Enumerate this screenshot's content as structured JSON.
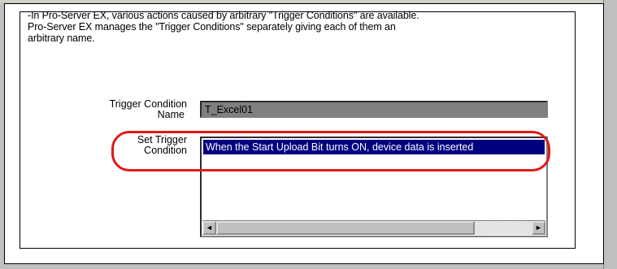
{
  "description": {
    "line1": "-In Pro-Server EX, various actions caused by arbitrary \"Trigger Conditions\" are available.",
    "line2": "Pro-Server EX manages the \"Trigger Conditions\" separately giving each of them an",
    "line3": "arbitrary name."
  },
  "trigger_condition_name": {
    "label_line1": "Trigger Condition",
    "label_line2": "Name",
    "value": "T_Excel01"
  },
  "set_trigger_condition": {
    "label_line1": "Set Trigger",
    "label_line2": "Condition",
    "selected_line": "When the Start Upload Bit turns ON, device data is inserted"
  },
  "scrollbar": {
    "left_arrow": "◄",
    "right_arrow": "►"
  },
  "colors": {
    "highlight_ring": "#e21818",
    "selection": "#000080",
    "disabled_field": "#808080"
  }
}
